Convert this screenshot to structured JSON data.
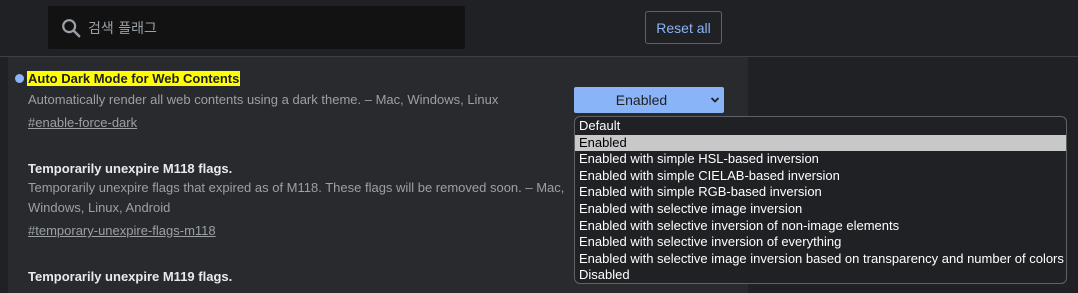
{
  "search": {
    "placeholder": "검색 플래그"
  },
  "reset_label": "Reset all",
  "flags": [
    {
      "title": "Auto Dark Mode for Web Contents",
      "description": "Automatically render all web contents using a dark theme. – Mac, Windows, Linux",
      "link": "#enable-force-dark",
      "selected_value": "Enabled"
    },
    {
      "title": "Temporarily unexpire M118 flags.",
      "description_line1": "Temporarily unexpire flags that expired as of M118. These flags will be removed soon. – Mac,",
      "description_line2": "Windows, Linux, Android",
      "link": "#temporary-unexpire-flags-m118"
    },
    {
      "title": "Temporarily unexpire M119 flags."
    }
  ],
  "dropdown": {
    "options": [
      "Default",
      "Enabled",
      "Enabled with simple HSL-based inversion",
      "Enabled with simple CIELAB-based inversion",
      "Enabled with simple RGB-based inversion",
      "Enabled with selective image inversion",
      "Enabled with selective inversion of non-image elements",
      "Enabled with selective inversion of everything",
      "Enabled with selective image inversion based on transparency and number of colors",
      "Disabled"
    ],
    "selected_index": 1
  },
  "colors": {
    "accent": "#8ab4f8",
    "highlight": "#ffff00",
    "background": "#202124",
    "panel": "#292a2d"
  }
}
